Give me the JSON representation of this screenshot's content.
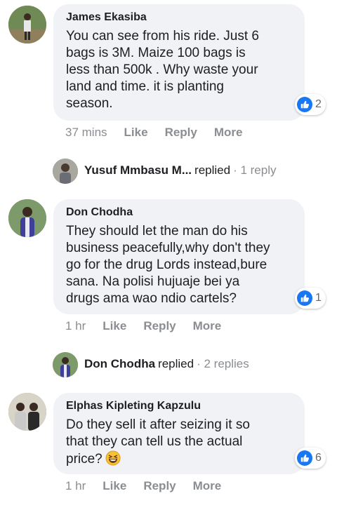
{
  "comments": [
    {
      "author": "James Ekasiba",
      "text": "You can see from his ride. Just 6\nbags is 3M. Maize 100 bags is\nless than 500k . Why waste your\nland and time. it is planting\nseason.",
      "reaction_icon": "like-icon",
      "reaction_count": "2",
      "time": "37 mins",
      "actions": [
        "Like",
        "Reply",
        "More"
      ]
    },
    {
      "author": "Don Chodha",
      "text": "They should let the man do his\nbusiness peacefully,why don't they\ngo for the drug Lords instead,bure\nsana. Na polisi hujuaje bei ya\ndrugs ama wao ndio cartels?",
      "reaction_icon": "like-icon",
      "reaction_count": "1",
      "time": "1 hr",
      "actions": [
        "Like",
        "Reply",
        "More"
      ]
    },
    {
      "author": "Elphas Kipleting Kapzulu",
      "text": "Do they sell it after seizing it so\nthat they can tell us the actual\nprice?",
      "emoji": "grinning-squinting-face",
      "reaction_icon": "like-icon",
      "reaction_count": "6",
      "time": "1 hr",
      "actions": [
        "Like",
        "Reply",
        "More"
      ]
    }
  ],
  "reply_rows": [
    {
      "name": "Yusuf Mmbasu M...",
      "verb": "replied",
      "count": "· 1 reply"
    },
    {
      "name": "Don Chodha",
      "verb": "replied",
      "count": "· 2 replies"
    }
  ],
  "colors": {
    "bubble": "#f0f2f5",
    "like_blue": "#1877f2",
    "meta_gray": "#8a8d91"
  }
}
